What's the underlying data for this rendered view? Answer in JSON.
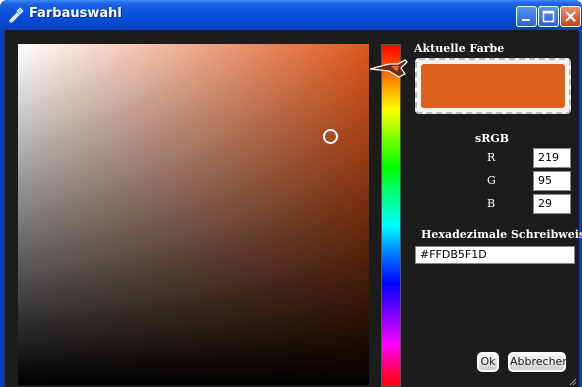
{
  "window": {
    "title": "Farbauswahl"
  },
  "current_color": {
    "label": "Aktuelle Farbe",
    "hex_color": "#DB5F1D"
  },
  "srgb": {
    "label": "sRGB",
    "r_label": "R",
    "g_label": "G",
    "b_label": "B",
    "r_value": "219",
    "g_value": "95",
    "b_value": "29"
  },
  "hex": {
    "label": "Hexadezimale Schreibweise",
    "value": "#FFDB5F1D"
  },
  "buttons": {
    "ok": "Ok",
    "cancel": "Abbrechen"
  },
  "icons": {
    "title": "eyedropper-icon",
    "minimize": "minimize-icon",
    "maximize": "maximize-icon",
    "close": "close-icon"
  }
}
